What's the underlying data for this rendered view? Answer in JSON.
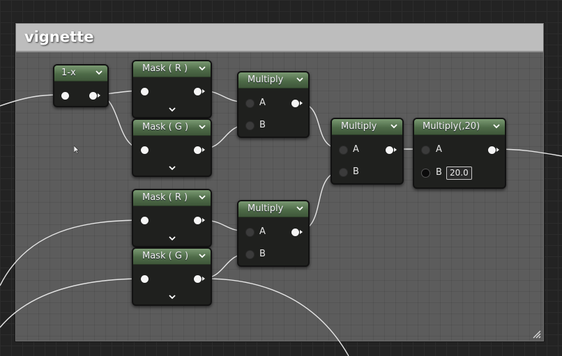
{
  "comment": {
    "title": "vignette"
  },
  "nodes": {
    "one_minus": {
      "title": "1-x"
    },
    "mask_r_1": {
      "title": "Mask ( R )"
    },
    "mask_g_1": {
      "title": "Mask ( G )"
    },
    "mask_r_2": {
      "title": "Mask ( R )"
    },
    "mask_g_2": {
      "title": "Mask ( G )"
    },
    "multiply_1": {
      "title": "Multiply",
      "pin_a": "A",
      "pin_b": "B"
    },
    "multiply_2": {
      "title": "Multiply",
      "pin_a": "A",
      "pin_b": "B"
    },
    "multiply_3": {
      "title": "Multiply",
      "pin_a": "A",
      "pin_b": "B"
    },
    "multiply_const": {
      "title": "Multiply(,20)",
      "pin_a": "A",
      "pin_b": "B",
      "b_value": "20.0"
    }
  },
  "colors": {
    "node_header": "#5a7a52",
    "comment_body": "#5c5c5c",
    "comment_header": "#bdbdbd",
    "wire": "#e6e6e6"
  }
}
